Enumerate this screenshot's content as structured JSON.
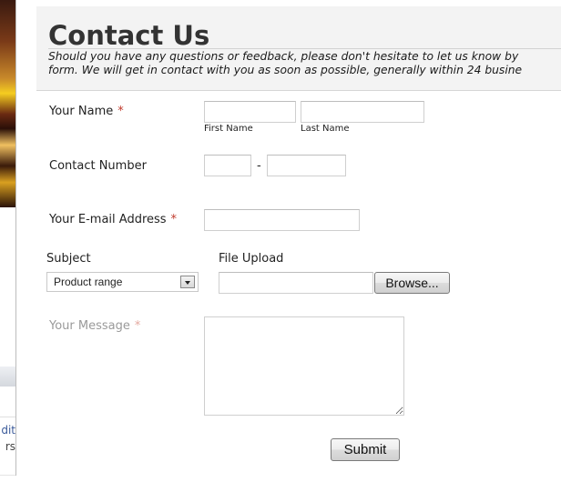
{
  "header": {
    "title": "Contact Us",
    "intro_line1": "Should you have any questions or feedback, please don't hesitate to let us know by",
    "intro_line2": "form. We will get in contact with you as soon as possible, generally within 24 busine"
  },
  "sidebar_fragment": {
    "text1": "dit",
    "text2": "rs"
  },
  "form": {
    "name": {
      "label": "Your Name",
      "required_mark": "*",
      "first_value": "",
      "last_value": "",
      "first_sublabel": "First Name",
      "last_sublabel": "Last Name"
    },
    "contact_number": {
      "label": "Contact Number",
      "separator": "-",
      "area_value": "",
      "number_value": ""
    },
    "email": {
      "label": "Your E-mail Address",
      "required_mark": "*",
      "value": ""
    },
    "subject": {
      "label": "Subject",
      "selected": "Product range"
    },
    "file_upload": {
      "label": "File Upload",
      "value": "",
      "browse_label": "Browse..."
    },
    "message": {
      "label": "Your Message",
      "required_mark": "*",
      "value": ""
    },
    "submit_label": "Submit"
  },
  "colors": {
    "required": "#c0392b",
    "header_bg": "#f3f3f3"
  }
}
